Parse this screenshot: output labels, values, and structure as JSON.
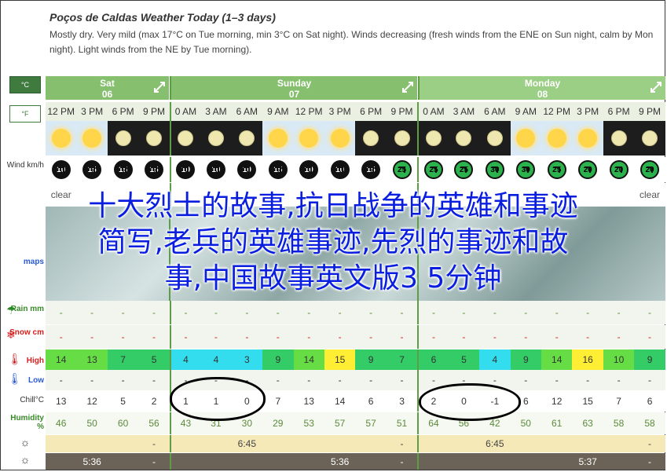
{
  "header": {
    "title": "Poços de Caldas Weather Today (1–3 days)",
    "description": "Mostly dry. Very mild (max 17°C on Tue morning, min 3°C on Sat night). Winds decreasing (fresh winds from the ENE on Sun night, calm by Mon night). Light winds from the NE by Tue morning)."
  },
  "units": {
    "celsius": "°C",
    "fahrenheit": "°F"
  },
  "days": [
    {
      "name": "Sat",
      "date": "06"
    },
    {
      "name": "Sunday",
      "date": "07"
    },
    {
      "name": "Monday",
      "date": "08"
    }
  ],
  "times": [
    "12 PM",
    "3 PM",
    "6 PM",
    "9 PM",
    "0 AM",
    "3 AM",
    "6 AM",
    "9 AM",
    "12 PM",
    "3 PM",
    "6 PM",
    "9 PM",
    "0 AM",
    "3 AM",
    "6 AM",
    "9 AM",
    "12 PM",
    "3 PM",
    "6 PM",
    "9 PM"
  ],
  "sky": [
    "sun",
    "sun",
    "moon",
    "moon",
    "moon",
    "moon",
    "moon",
    "sun",
    "sun",
    "sun",
    "moon",
    "moon",
    "moon",
    "moon",
    "moon",
    "sun",
    "sun",
    "sun",
    "moon",
    "moon"
  ],
  "row_labels": {
    "wind": "Wind km/h",
    "maps": "maps",
    "rain": "Rain mm",
    "snow": "Snow cm",
    "high": "High",
    "low": "Low",
    "chill": "Chill°C",
    "humidity": "Humidity %"
  },
  "wind": [
    "10",
    "15",
    "15",
    "15",
    "10",
    "10",
    "10",
    "15",
    "10",
    "10",
    "15",
    "25",
    "25",
    "25",
    "30",
    "30",
    "25",
    "20",
    "20",
    "20"
  ],
  "wind_colors": [
    "black",
    "black",
    "black",
    "black",
    "black",
    "black",
    "black",
    "black",
    "black",
    "black",
    "black",
    "green",
    "green",
    "green",
    "green",
    "green",
    "green",
    "green",
    "green",
    "green"
  ],
  "conditions": [
    "clear",
    "",
    "",
    "",
    "",
    "",
    "",
    "",
    "",
    "",
    "",
    "",
    "",
    "",
    "",
    "",
    "",
    "",
    "",
    "clear"
  ],
  "rain": [
    "-",
    "-",
    "-",
    "-",
    "-",
    "-",
    "-",
    "-",
    "-",
    "-",
    "-",
    "-",
    "-",
    "-",
    "-",
    "-",
    "-",
    "-",
    "-",
    "-"
  ],
  "snow": [
    "-",
    "-",
    "-",
    "-",
    "-",
    "-",
    "-",
    "-",
    "-",
    "-",
    "-",
    "-",
    "-",
    "-",
    "-",
    "-",
    "-",
    "-",
    "-",
    "-"
  ],
  "high": [
    "14",
    "13",
    "7",
    "5",
    "4",
    "4",
    "3",
    "9",
    "14",
    "15",
    "9",
    "7",
    "6",
    "5",
    "4",
    "9",
    "14",
    "16",
    "10",
    "9"
  ],
  "high_colors": [
    "#66dd44",
    "#66dd44",
    "#33cc66",
    "#33cc66",
    "#33ddee",
    "#33ddee",
    "#33ddee",
    "#33cc66",
    "#66dd44",
    "#ffee33",
    "#33cc66",
    "#33cc66",
    "#33cc66",
    "#33cc66",
    "#33ddee",
    "#33cc66",
    "#66dd44",
    "#ffee33",
    "#66dd44",
    "#33cc66"
  ],
  "low": [
    "-",
    "-",
    "-",
    "-",
    "-",
    "-",
    "-",
    "-",
    "-",
    "-",
    "-",
    "-",
    "-",
    "-",
    "-",
    "-",
    "-",
    "-",
    "-",
    "-"
  ],
  "chill": [
    "13",
    "12",
    "5",
    "2",
    "1",
    "1",
    "0",
    "7",
    "13",
    "14",
    "6",
    "3",
    "2",
    "0",
    "-1",
    "6",
    "12",
    "15",
    "7",
    "6"
  ],
  "humidity": [
    "46",
    "50",
    "60",
    "56",
    "43",
    "31",
    "30",
    "29",
    "53",
    "57",
    "57",
    "51",
    "64",
    "56",
    "42",
    "50",
    "61",
    "63",
    "58",
    "58"
  ],
  "sunrise": [
    "",
    "",
    "",
    "-",
    "",
    "",
    "6:45",
    "",
    "",
    "",
    "",
    "-",
    "",
    "",
    "6:45",
    "",
    "",
    "",
    "",
    "-"
  ],
  "sunset": [
    "",
    "5:36",
    "",
    "-",
    "",
    "",
    "",
    "",
    "",
    "5:36",
    "",
    "-",
    "",
    "",
    "",
    "",
    "",
    "5:37",
    "",
    "-"
  ],
  "overlay": {
    "line1": "十大烈士的故事,抗日战争的英雄和事迹",
    "line2": "简写,老兵的英雄事迹,先烈的事迹和故",
    "line3": "事,中国故事英文版3 5分钟"
  }
}
